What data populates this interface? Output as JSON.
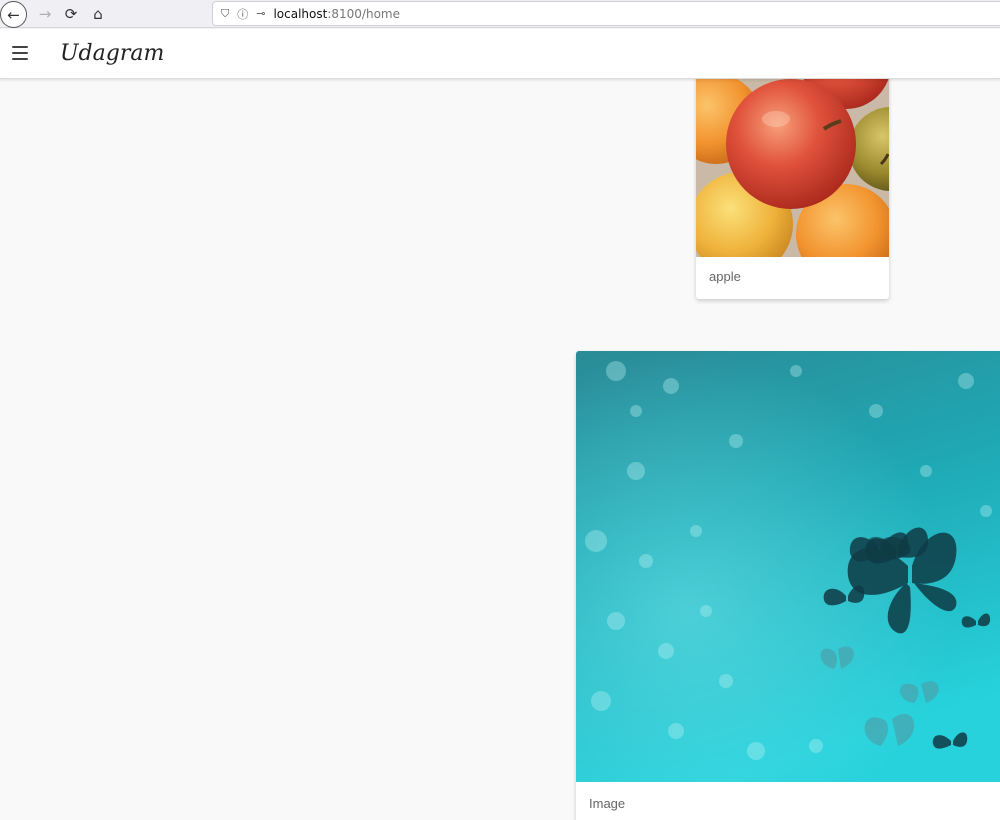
{
  "browser": {
    "url_host": "localhost",
    "url_path": ":8100/home",
    "icons": [
      "back-icon",
      "forward-icon",
      "reload-icon",
      "home-icon",
      "shield-icon",
      "info-icon",
      "key-icon"
    ]
  },
  "toolbar": {
    "title": "Udagram"
  },
  "feed": {
    "items": [
      {
        "caption": "apple",
        "image": "apples-photo"
      },
      {
        "caption": "Image",
        "image": "butterflies-photo"
      }
    ]
  },
  "colors": {
    "background": "#f9f9f9",
    "toolbar": "#ffffff",
    "caption_text": "#666666"
  }
}
